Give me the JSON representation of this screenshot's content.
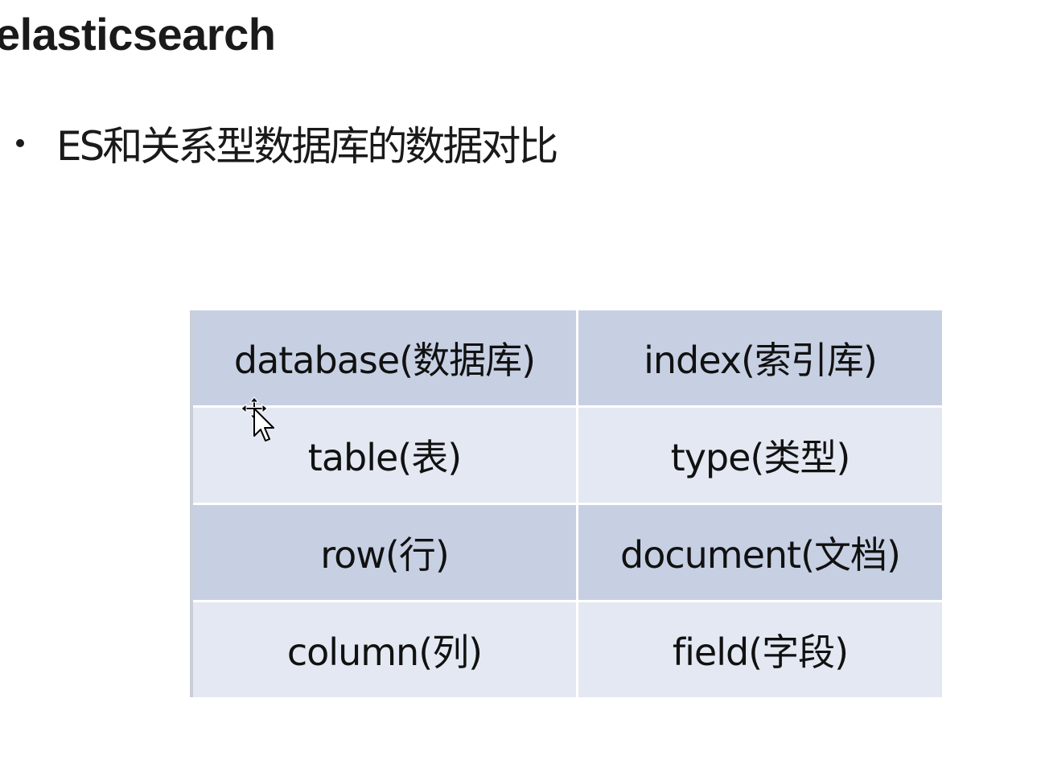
{
  "title": "elasticsearch",
  "bullet": "ES和关系型数据库的数据对比",
  "table": {
    "rows": [
      {
        "relational": "database(数据库)",
        "elasticsearch": "index(索引库)"
      },
      {
        "relational": "table(表)",
        "elasticsearch": "type(类型)"
      },
      {
        "relational": "row(行)",
        "elasticsearch": "document(文档)"
      },
      {
        "relational": "column(列)",
        "elasticsearch": "field(字段)"
      }
    ]
  },
  "colors": {
    "row_dark": "#c7d0e3",
    "row_light": "#e3e8f2",
    "text": "#111111"
  },
  "icons": {
    "bullet": "bullet-dot",
    "cursor": "move-cursor-icon"
  }
}
